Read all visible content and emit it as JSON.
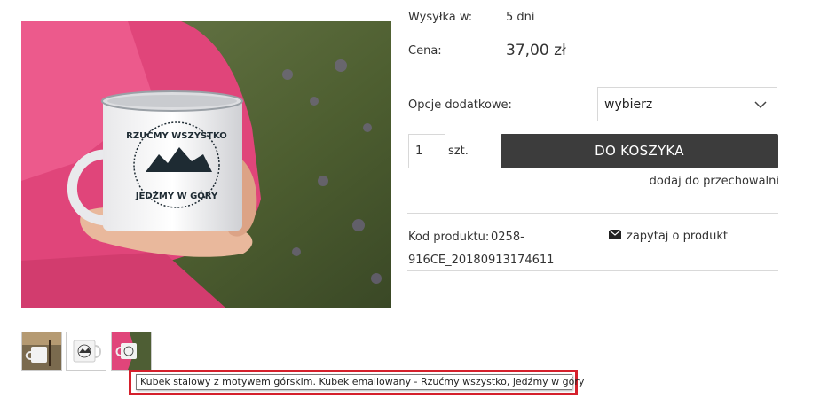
{
  "product": {
    "shipping_label": "Wysyłka w:",
    "shipping_value": "5 dni",
    "price_label": "Cena:",
    "price_value": "37,00 zł",
    "options_label": "Opcje dodatkowe:",
    "options_selected": "wybierz",
    "quantity_value": "1",
    "quantity_unit": "szt.",
    "add_to_cart_label": "DO KOSZYKA",
    "wishlist_label": "dodaj do przechowalni",
    "code_label": "Kod produktu:",
    "code_value_line1": "0258-",
    "code_value_line2": "916CE_20180913174611",
    "ask_label": "zapytaj o produkt",
    "mug_text_top": "RZUĆMY WSZYSTKO",
    "mug_text_bottom": "JEDŹMY W GÓRY"
  },
  "tooltip": {
    "text": "Kubek stalowy z motywem górskim. Kubek emaliowany - Rzućmy wszystko, jedźmy w góry"
  },
  "icons": {
    "select_chevron": "chevron-down-icon",
    "ask": "envelope-icon"
  },
  "colors": {
    "button_bg": "#3c3c3c",
    "highlight": "#d5202c"
  }
}
